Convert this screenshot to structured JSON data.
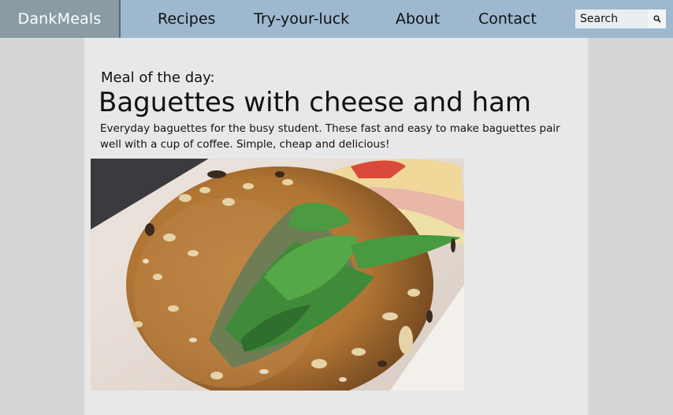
{
  "header": {
    "brand": "DankMeals",
    "nav": [
      {
        "label": "Recipes"
      },
      {
        "label": "Try-your-luck"
      },
      {
        "label": "About"
      },
      {
        "label": "Contact"
      }
    ],
    "search": {
      "placeholder": "Search",
      "icon": "search-icon"
    }
  },
  "main": {
    "eyebrow": "Meal of the day:",
    "title": "Baguettes with cheese and ham",
    "description": "Everyday baguettes for the busy student. These fast and easy to make baguettes pair well with a cup of coffee. Simple, cheap and delicious!",
    "image_icon": "baguette-photo"
  },
  "colors": {
    "navbar": "#9db8cf",
    "brand_bg": "#8a9ba3",
    "page_bg": "#d6d6d6",
    "content_bg": "#e8e8e8"
  }
}
